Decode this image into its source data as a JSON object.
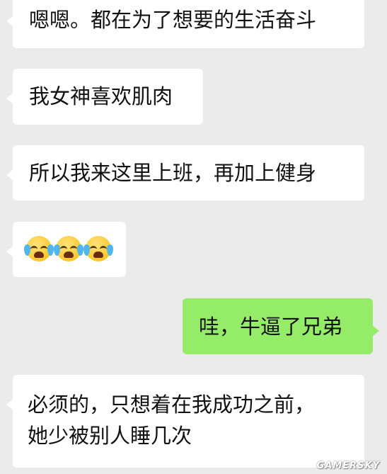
{
  "messages": [
    {
      "side": "in",
      "text": "嗯嗯。都在为了想要的生活奋斗"
    },
    {
      "side": "in",
      "text": "我女神喜欢肌肉"
    },
    {
      "side": "in",
      "text": "所以我来这里上班，再加上健身"
    },
    {
      "side": "in",
      "emojis": [
        "crying-laughing-emoji",
        "crying-laughing-emoji",
        "crying-laughing-emoji"
      ]
    },
    {
      "side": "out",
      "text": "哇，牛逼了兄弟"
    },
    {
      "side": "in",
      "text_lines": [
        "必须的，只想着在我成功之前，",
        "她少被别人睡几次"
      ]
    }
  ],
  "watermark": "GAMERSKY",
  "colors": {
    "background": "#ebebeb",
    "incoming_bubble": "#ffffff",
    "outgoing_bubble": "#95ec69"
  }
}
